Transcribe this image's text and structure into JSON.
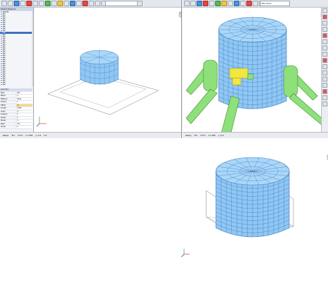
{
  "window1": {
    "toolbar": {
      "combo": ""
    },
    "tree_title": "Model Explorer",
    "tree_items": [
      "Results",
      "Bar",
      "Bar",
      "Bar",
      "Bar",
      "Bar",
      "Bar",
      "Bar",
      "Bar",
      "Bar",
      "Bar",
      "Bar",
      "Bar",
      "Bar",
      "Bar",
      "Bar",
      "Bar",
      "Bar",
      "Bar",
      "Bar",
      "Bar",
      "Bar",
      "Bar",
      "Bar",
      "Bar",
      "Bar",
      "Bar",
      "Bar",
      "Bar",
      "Bar",
      "Bar",
      "Bar",
      "Bar",
      "Bar",
      "Bar",
      "Bar"
    ],
    "selected_index": 10,
    "props_title": "Geometry",
    "props": [
      [
        "Type",
        "Bar"
      ],
      [
        "Name",
        "1"
      ],
      [
        "Material",
        "Steel"
      ],
      [
        "Section",
        "1"
      ],
      [
        "Offset",
        "0"
      ],
      [
        "Length",
        "1000"
      ],
      [
        "Angle",
        "0"
      ],
      [
        "Property",
        "1"
      ],
      [
        "Node1",
        "1"
      ],
      [
        "Node2",
        "2"
      ],
      [
        "Mass",
        "0.5"
      ],
      [
        "Group",
        "1"
      ]
    ],
    "status": [
      "Ready",
      "N:1",
      "1:E:0",
      "x:1.005",
      "y:-1.6",
      "z:0"
    ]
  },
  "window2": {
    "toolbar": {
      "combo": "Structure"
    },
    "status": [
      "Ready",
      "N:1",
      "1:E:0",
      "x:1.005",
      "y:-1.6"
    ]
  },
  "colors": {
    "mesh_blue": "#8fc7f5",
    "mesh_line": "#3a6fb0",
    "support_green": "#8ee07a",
    "support_line": "#3e8a2f",
    "highlight_yellow": "#f2e640",
    "toolbar_bg": "#e4e8ee"
  }
}
